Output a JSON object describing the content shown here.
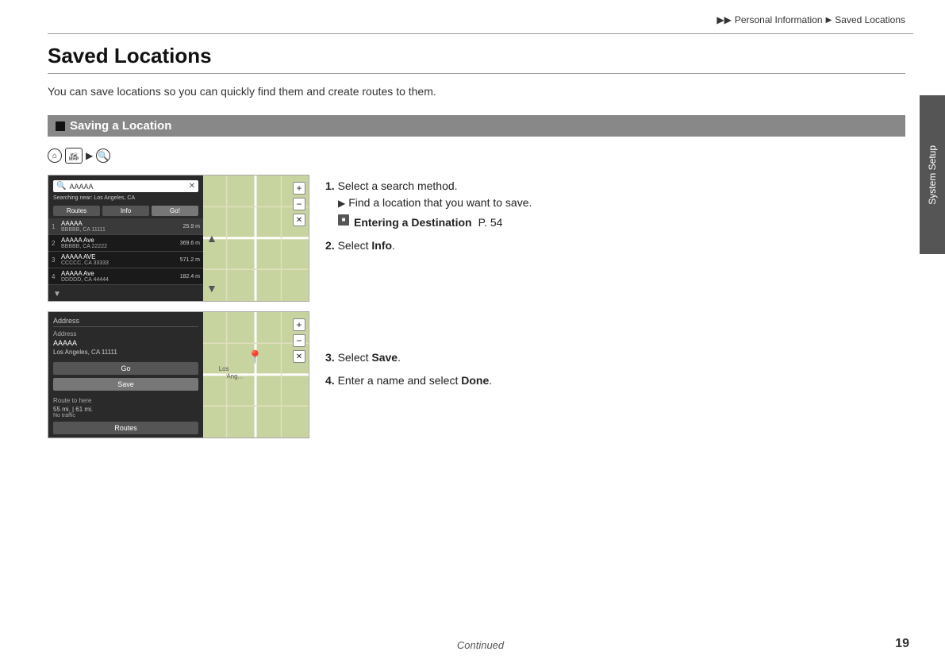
{
  "breadcrumb": {
    "arrow1": "▶▶",
    "section1": "Personal Information",
    "arrow2": "▶",
    "section2": "Saved Locations"
  },
  "page": {
    "title": "Saved Locations",
    "intro": "You can save locations so you can quickly find them and create routes to them."
  },
  "section": {
    "title": "Saving a Location"
  },
  "sidebar_tab": {
    "label": "System Setup"
  },
  "steps": {
    "step1_label": "1.",
    "step1_text": "Select a search method.",
    "step1_sub1": "Find a location that you want to save.",
    "step1_ref_icon": "■",
    "step1_ref_text": "Entering a Destination",
    "step1_ref_page": "P. 54",
    "step2_label": "2.",
    "step2_text": "Select ",
    "step2_bold": "Info",
    "step2_end": ".",
    "step3_label": "3.",
    "step3_text": "Select ",
    "step3_bold": "Save",
    "step3_end": ".",
    "step4_label": "4.",
    "step4_text": "Enter a name and select ",
    "step4_bold": "Done",
    "step4_end": "."
  },
  "screenshots": {
    "ss1": {
      "search_text": "AAAAA",
      "searching_near": "Searching near:",
      "location": "Los Angeles, CA",
      "items": [
        {
          "num": "1",
          "name": "AAAAA",
          "addr": "BBBBB, CA 11111",
          "dist": "25.9 m",
          "selected": true
        },
        {
          "num": "2",
          "name": "AAAAA Ave",
          "addr": "BBBBB, CA 22222",
          "dist": "369.6 m"
        },
        {
          "num": "3",
          "name": "AAAAA AVE",
          "addr": "CCCCC, CA 33333",
          "dist": "571.2 m"
        },
        {
          "num": "4",
          "name": "AAAAA Ave",
          "addr": "DDDDD, CA 44444",
          "dist": "182.4 m"
        }
      ],
      "btn_routes": "Routes",
      "btn_info": "Info",
      "btn_go": "Go!"
    },
    "ss2": {
      "section_title": "Address",
      "address_label": "Address",
      "name": "AAAAA",
      "city": "Los Angeles, CA 11111",
      "btn_go": "Go",
      "btn_save": "Save",
      "route_section": "Route to here",
      "route_info": "55 mi. | 61 mi.",
      "traffic": "No traffic",
      "btn_routes": "Routes"
    }
  },
  "footer": {
    "continued": "Continued",
    "page_number": "19"
  }
}
